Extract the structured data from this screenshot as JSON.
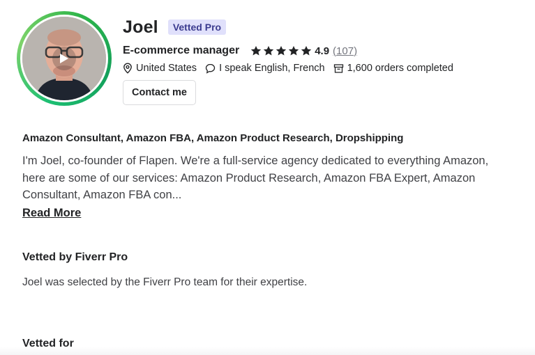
{
  "profile": {
    "name": "Joel",
    "badge": "Vetted Pro",
    "job_title": "E-commerce manager",
    "rating": "4.9",
    "stars": 5,
    "reviews": "(107)",
    "location": "United States",
    "languages": "I speak English, French",
    "orders": "1,600 orders completed",
    "contact_label": "Contact me",
    "ring_color": "#1dbf73"
  },
  "about": {
    "skills": "Amazon Consultant, Amazon FBA, Amazon Product Research, Dropshipping",
    "bio_line1": "I'm Joel, co-founder of Flapen. We're a full-service agency dedicated to everything Amazon,",
    "bio_line2": "here are some of our services: Amazon Product Research, Amazon FBA Expert, Amazon",
    "bio_line3": "Consultant, Amazon FBA con...",
    "read_more": "Read More"
  },
  "vetted": {
    "heading": "Vetted by Fiverr Pro",
    "text": "Joel was selected by the Fiverr Pro team for their expertise.",
    "vetted_for": "Vetted for"
  },
  "icons": {
    "location": "location-pin-icon",
    "language": "speech-bubble-icon",
    "orders": "archive-box-icon",
    "star": "star-icon",
    "play": "play-icon"
  }
}
